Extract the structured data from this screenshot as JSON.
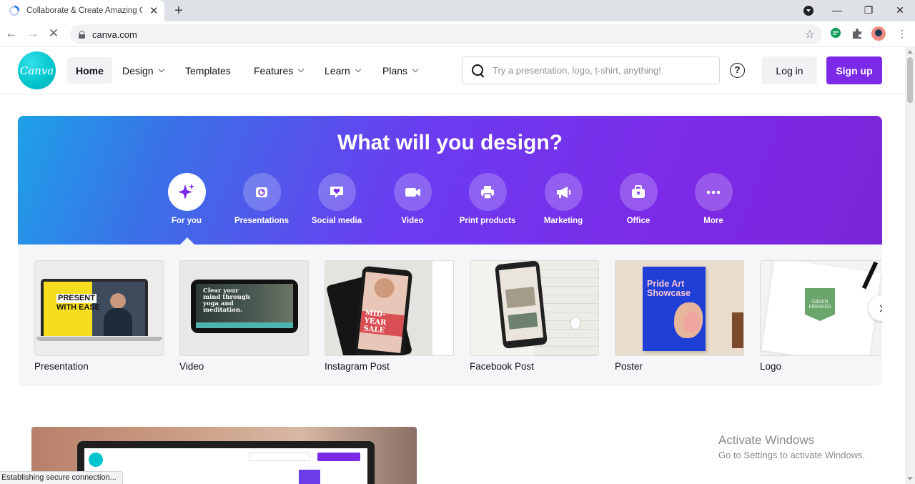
{
  "browser": {
    "tab_title": "Collaborate & Create Amazing G",
    "url": "canva.com",
    "status_text": "Establishing secure connection..."
  },
  "header": {
    "logo_text": "Canva",
    "nav": [
      {
        "label": "Home"
      },
      {
        "label": "Design"
      },
      {
        "label": "Templates"
      },
      {
        "label": "Features"
      },
      {
        "label": "Learn"
      },
      {
        "label": "Plans"
      }
    ],
    "search_placeholder": "Try a presentation, logo, t-shirt, anything!",
    "help_label": "?",
    "login_label": "Log in",
    "signup_label": "Sign up"
  },
  "hero": {
    "title": "What will you design?",
    "categories": [
      {
        "label": "For you",
        "icon": "sparkle-icon"
      },
      {
        "label": "Presentations",
        "icon": "presentation-icon"
      },
      {
        "label": "Social media",
        "icon": "heart-chat-icon"
      },
      {
        "label": "Video",
        "icon": "video-camera-icon"
      },
      {
        "label": "Print products",
        "icon": "printer-icon"
      },
      {
        "label": "Marketing",
        "icon": "megaphone-icon"
      },
      {
        "label": "Office",
        "icon": "briefcase-icon"
      },
      {
        "label": "More",
        "icon": "more-dots-icon"
      }
    ]
  },
  "cards": [
    {
      "label": "Presentation",
      "art_text": [
        "PRESENT",
        "WITH EASE"
      ]
    },
    {
      "label": "Video",
      "art_text": [
        "Clear your",
        "mind through",
        "yoga and",
        "meditation."
      ]
    },
    {
      "label": "Instagram Post",
      "art_text": [
        "MID-YEAR",
        "SALE"
      ]
    },
    {
      "label": "Facebook Post",
      "art_text": []
    },
    {
      "label": "Poster",
      "art_text": [
        "Pride Art",
        "Showcase"
      ]
    },
    {
      "label": "Logo",
      "art_text": [
        "GREEN",
        "FRESHER"
      ]
    }
  ],
  "watermark": {
    "line1": "Activate Windows",
    "line2": "Go to Settings to activate Windows."
  },
  "colors": {
    "brand_purple": "#7d2ae8",
    "brand_teal": "#00c4cc"
  }
}
